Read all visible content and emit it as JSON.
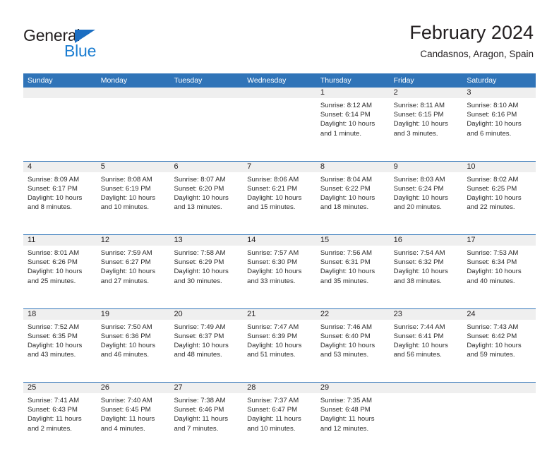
{
  "brand": {
    "name_part1": "General",
    "name_part2": "Blue",
    "color_dark": "#231f20",
    "color_blue": "#1b7dd1",
    "triangle_color": "#1b6ec2"
  },
  "header": {
    "title": "February 2024",
    "subtitle": "Candasnos, Aragon, Spain"
  },
  "theme": {
    "header_blue": "#3074b8",
    "daynum_band": "#efefef",
    "text": "#231f20"
  },
  "calendar": {
    "weekday_headers": [
      "Sunday",
      "Monday",
      "Tuesday",
      "Wednesday",
      "Thursday",
      "Friday",
      "Saturday"
    ],
    "weeks": [
      [
        {
          "day": "",
          "lines": []
        },
        {
          "day": "",
          "lines": []
        },
        {
          "day": "",
          "lines": []
        },
        {
          "day": "",
          "lines": []
        },
        {
          "day": "1",
          "lines": [
            "Sunrise: 8:12 AM",
            "Sunset: 6:14 PM",
            "Daylight: 10 hours",
            "and 1 minute."
          ]
        },
        {
          "day": "2",
          "lines": [
            "Sunrise: 8:11 AM",
            "Sunset: 6:15 PM",
            "Daylight: 10 hours",
            "and 3 minutes."
          ]
        },
        {
          "day": "3",
          "lines": [
            "Sunrise: 8:10 AM",
            "Sunset: 6:16 PM",
            "Daylight: 10 hours",
            "and 6 minutes."
          ]
        }
      ],
      [
        {
          "day": "4",
          "lines": [
            "Sunrise: 8:09 AM",
            "Sunset: 6:17 PM",
            "Daylight: 10 hours",
            "and 8 minutes."
          ]
        },
        {
          "day": "5",
          "lines": [
            "Sunrise: 8:08 AM",
            "Sunset: 6:19 PM",
            "Daylight: 10 hours",
            "and 10 minutes."
          ]
        },
        {
          "day": "6",
          "lines": [
            "Sunrise: 8:07 AM",
            "Sunset: 6:20 PM",
            "Daylight: 10 hours",
            "and 13 minutes."
          ]
        },
        {
          "day": "7",
          "lines": [
            "Sunrise: 8:06 AM",
            "Sunset: 6:21 PM",
            "Daylight: 10 hours",
            "and 15 minutes."
          ]
        },
        {
          "day": "8",
          "lines": [
            "Sunrise: 8:04 AM",
            "Sunset: 6:22 PM",
            "Daylight: 10 hours",
            "and 18 minutes."
          ]
        },
        {
          "day": "9",
          "lines": [
            "Sunrise: 8:03 AM",
            "Sunset: 6:24 PM",
            "Daylight: 10 hours",
            "and 20 minutes."
          ]
        },
        {
          "day": "10",
          "lines": [
            "Sunrise: 8:02 AM",
            "Sunset: 6:25 PM",
            "Daylight: 10 hours",
            "and 22 minutes."
          ]
        }
      ],
      [
        {
          "day": "11",
          "lines": [
            "Sunrise: 8:01 AM",
            "Sunset: 6:26 PM",
            "Daylight: 10 hours",
            "and 25 minutes."
          ]
        },
        {
          "day": "12",
          "lines": [
            "Sunrise: 7:59 AM",
            "Sunset: 6:27 PM",
            "Daylight: 10 hours",
            "and 27 minutes."
          ]
        },
        {
          "day": "13",
          "lines": [
            "Sunrise: 7:58 AM",
            "Sunset: 6:29 PM",
            "Daylight: 10 hours",
            "and 30 minutes."
          ]
        },
        {
          "day": "14",
          "lines": [
            "Sunrise: 7:57 AM",
            "Sunset: 6:30 PM",
            "Daylight: 10 hours",
            "and 33 minutes."
          ]
        },
        {
          "day": "15",
          "lines": [
            "Sunrise: 7:56 AM",
            "Sunset: 6:31 PM",
            "Daylight: 10 hours",
            "and 35 minutes."
          ]
        },
        {
          "day": "16",
          "lines": [
            "Sunrise: 7:54 AM",
            "Sunset: 6:32 PM",
            "Daylight: 10 hours",
            "and 38 minutes."
          ]
        },
        {
          "day": "17",
          "lines": [
            "Sunrise: 7:53 AM",
            "Sunset: 6:34 PM",
            "Daylight: 10 hours",
            "and 40 minutes."
          ]
        }
      ],
      [
        {
          "day": "18",
          "lines": [
            "Sunrise: 7:52 AM",
            "Sunset: 6:35 PM",
            "Daylight: 10 hours",
            "and 43 minutes."
          ]
        },
        {
          "day": "19",
          "lines": [
            "Sunrise: 7:50 AM",
            "Sunset: 6:36 PM",
            "Daylight: 10 hours",
            "and 46 minutes."
          ]
        },
        {
          "day": "20",
          "lines": [
            "Sunrise: 7:49 AM",
            "Sunset: 6:37 PM",
            "Daylight: 10 hours",
            "and 48 minutes."
          ]
        },
        {
          "day": "21",
          "lines": [
            "Sunrise: 7:47 AM",
            "Sunset: 6:39 PM",
            "Daylight: 10 hours",
            "and 51 minutes."
          ]
        },
        {
          "day": "22",
          "lines": [
            "Sunrise: 7:46 AM",
            "Sunset: 6:40 PM",
            "Daylight: 10 hours",
            "and 53 minutes."
          ]
        },
        {
          "day": "23",
          "lines": [
            "Sunrise: 7:44 AM",
            "Sunset: 6:41 PM",
            "Daylight: 10 hours",
            "and 56 minutes."
          ]
        },
        {
          "day": "24",
          "lines": [
            "Sunrise: 7:43 AM",
            "Sunset: 6:42 PM",
            "Daylight: 10 hours",
            "and 59 minutes."
          ]
        }
      ],
      [
        {
          "day": "25",
          "lines": [
            "Sunrise: 7:41 AM",
            "Sunset: 6:43 PM",
            "Daylight: 11 hours",
            "and 2 minutes."
          ]
        },
        {
          "day": "26",
          "lines": [
            "Sunrise: 7:40 AM",
            "Sunset: 6:45 PM",
            "Daylight: 11 hours",
            "and 4 minutes."
          ]
        },
        {
          "day": "27",
          "lines": [
            "Sunrise: 7:38 AM",
            "Sunset: 6:46 PM",
            "Daylight: 11 hours",
            "and 7 minutes."
          ]
        },
        {
          "day": "28",
          "lines": [
            "Sunrise: 7:37 AM",
            "Sunset: 6:47 PM",
            "Daylight: 11 hours",
            "and 10 minutes."
          ]
        },
        {
          "day": "29",
          "lines": [
            "Sunrise: 7:35 AM",
            "Sunset: 6:48 PM",
            "Daylight: 11 hours",
            "and 12 minutes."
          ]
        },
        {
          "day": "",
          "lines": []
        },
        {
          "day": "",
          "lines": []
        }
      ]
    ]
  }
}
